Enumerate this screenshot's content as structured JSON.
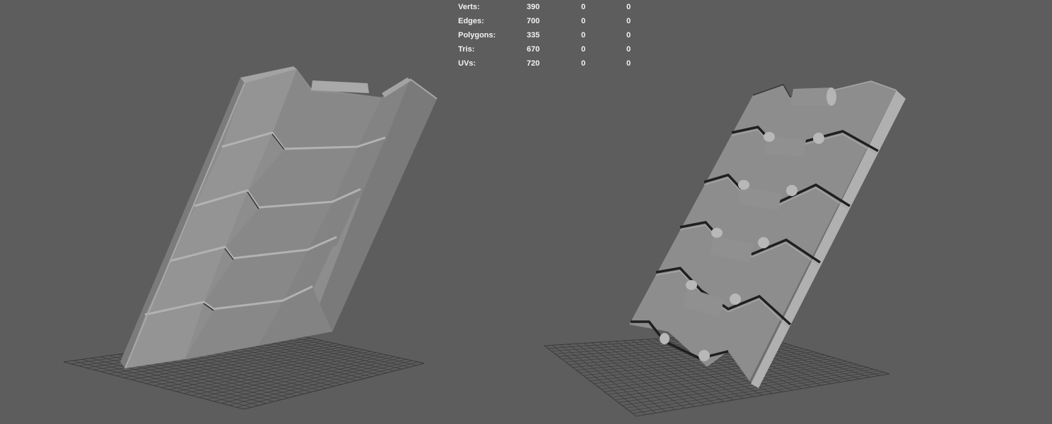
{
  "hud": {
    "rows": [
      {
        "label": "Verts:",
        "v1": "390",
        "v2": "0",
        "v3": "0"
      },
      {
        "label": "Edges:",
        "v1": "700",
        "v2": "0",
        "v3": "0"
      },
      {
        "label": "Polygons:",
        "v1": "335",
        "v2": "0",
        "v3": "0"
      },
      {
        "label": "Tris:",
        "v1": "670",
        "v2": "0",
        "v3": "0"
      },
      {
        "label": "UVs:",
        "v1": "720",
        "v2": "0",
        "v3": "0"
      }
    ]
  },
  "colors": {
    "background": "#5d5d5d",
    "mesh_light": "#9a9a9a",
    "mesh_mid": "#8a8a8a",
    "mesh_dark": "#6f6f6f",
    "grid": "#3a3a3a"
  }
}
